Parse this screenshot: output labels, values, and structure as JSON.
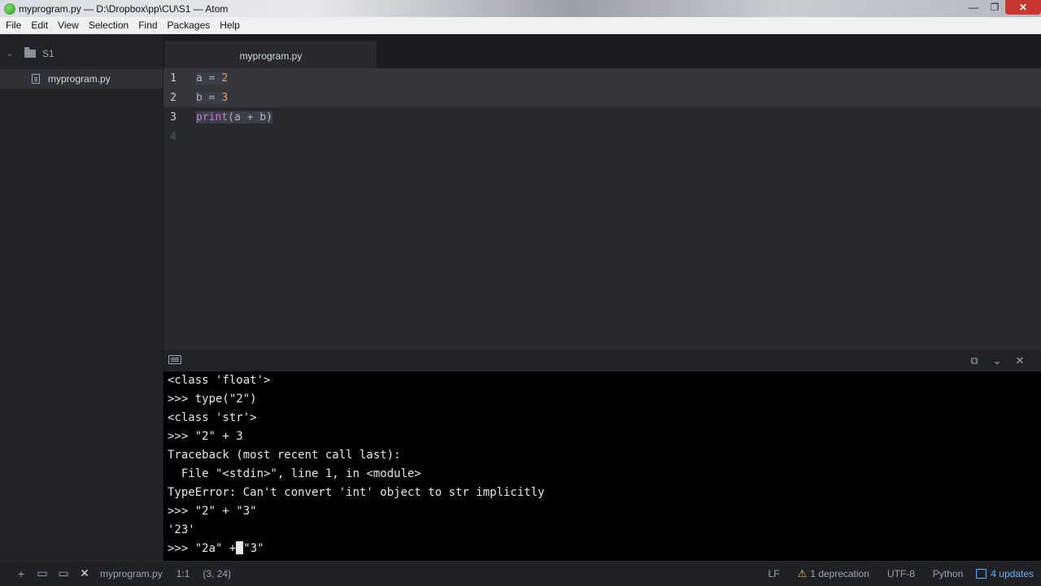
{
  "window": {
    "title": "myprogram.py — D:\\Dropbox\\pp\\CU\\S1 — Atom",
    "min": "—",
    "max": "❐",
    "close": "✕"
  },
  "menu": [
    "File",
    "Edit",
    "View",
    "Selection",
    "Find",
    "Packages",
    "Help"
  ],
  "sidebar": {
    "root": "S1",
    "file": "myprogram.py"
  },
  "tab": {
    "label": "myprogram.py"
  },
  "editor": {
    "lines": [
      {
        "n": "1",
        "parts": [
          [
            "a",
            ""
          ],
          [
            " = ",
            ""
          ],
          [
            "2",
            "num"
          ]
        ]
      },
      {
        "n": "2",
        "parts": [
          [
            "b",
            ""
          ],
          [
            " = ",
            ""
          ],
          [
            "3",
            "num"
          ]
        ]
      },
      {
        "n": "3",
        "parts": [
          [
            "print",
            "kw"
          ],
          [
            "(a + b)",
            ""
          ]
        ]
      },
      {
        "n": "4",
        "parts": []
      }
    ]
  },
  "terminal": {
    "lines": [
      "<class 'float'>",
      ">>> type(\"2\")",
      "<class 'str'>",
      ">>> \"2\" + 3",
      "Traceback (most recent call last):",
      "  File \"<stdin>\", line 1, in <module>",
      "TypeError: Can't convert 'int' object to str implicitly",
      ">>> \"2\" + \"3\"",
      "'23'"
    ],
    "input_before": ">>> \"2a\" +",
    "input_after": "\"3\""
  },
  "status": {
    "add": "+",
    "file": "myprogram.py",
    "position": "1:1",
    "selection": "(3, 24)",
    "line_ending": "LF",
    "deprecation": "1 deprecation",
    "encoding": "UTF-8",
    "grammar": "Python",
    "updates": "4 updates"
  }
}
